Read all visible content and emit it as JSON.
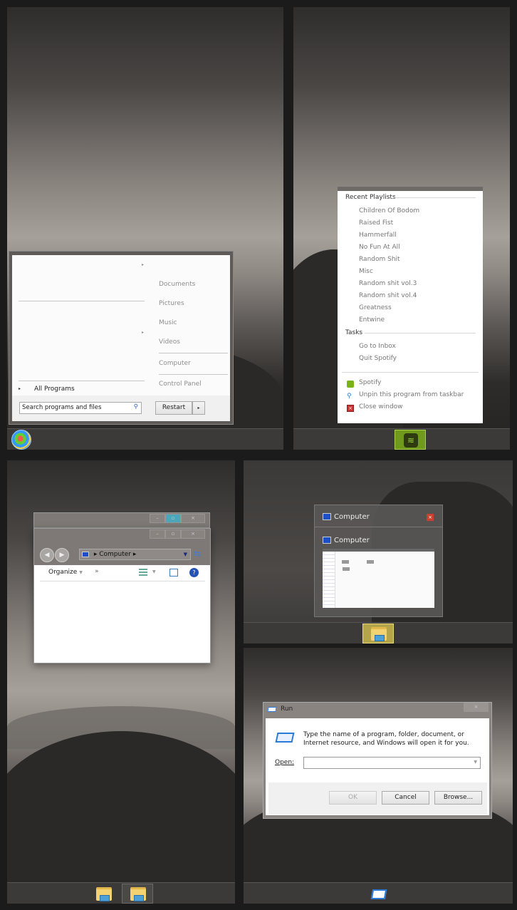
{
  "start_menu": {
    "right_items": [
      "Documents",
      "Pictures",
      "Music",
      "Videos",
      "Computer",
      "Control Panel"
    ],
    "all_programs": "All Programs",
    "search_placeholder": "Search programs and files",
    "shutdown_label": "Restart"
  },
  "jump_list": {
    "recent_header": "Recent Playlists",
    "playlists": [
      "Children Of Bodom",
      "Raised Fist",
      "Hammerfall",
      "No Fun At All",
      "Random Shit",
      "Misc",
      "Random shit vol.3",
      "Random shit vol.4",
      "Greatness",
      "Entwine"
    ],
    "tasks_header": "Tasks",
    "tasks": [
      "Go to Inbox",
      "Quit Spotify"
    ],
    "actions": [
      "Spotify",
      "Unpin this program from taskbar",
      "Close window"
    ],
    "accent": "#7ab317"
  },
  "explorer": {
    "address": "Computer",
    "toolbar": {
      "organize": "Organize",
      "more": "»"
    }
  },
  "thumbnails": {
    "titles": [
      "Computer",
      "Computer"
    ]
  },
  "run_dialog": {
    "title": "Run",
    "description": "Type the name of a program, folder, document, or Internet resource, and Windows will open it for you.",
    "open_label": "Open:",
    "open_value": "",
    "ok": "OK",
    "cancel": "Cancel",
    "browse": "Browse..."
  }
}
